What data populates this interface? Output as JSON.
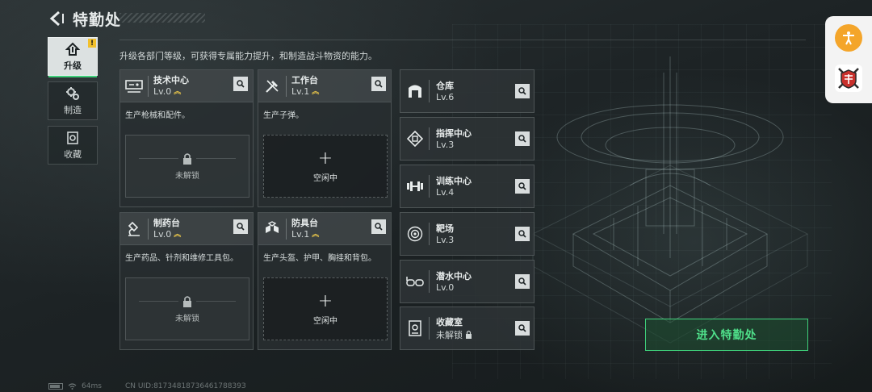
{
  "header": {
    "title": "特勤处"
  },
  "description": "升级各部门等级，可获得专属能力提升，和制造战斗物资的能力。",
  "nav": [
    {
      "label": "升级",
      "icon": "upgrade-icon",
      "active": true,
      "badge": "!"
    },
    {
      "label": "制造",
      "icon": "gear-icon",
      "active": false
    },
    {
      "label": "收藏",
      "icon": "collection-icon",
      "active": false
    }
  ],
  "cards": [
    {
      "name": "技术中心",
      "level": "Lv.0",
      "desc": "生产枪械和配件。",
      "slot": "未解锁",
      "icon": "tech-center-icon"
    },
    {
      "name": "工作台",
      "level": "Lv.1",
      "desc": "生产子弹。",
      "slot": "空闲中",
      "icon": "workbench-icon"
    },
    {
      "name": "制药台",
      "level": "Lv.0",
      "desc": "生产药品、针剂和维修工具包。",
      "slot": "未解锁",
      "icon": "pharmacy-icon"
    },
    {
      "name": "防具台",
      "level": "Lv.1",
      "desc": "生产头盔、护甲、胸挂和背包。",
      "slot": "空闲中",
      "icon": "armor-bench-icon"
    }
  ],
  "list": [
    {
      "name": "仓库",
      "level": "Lv.6",
      "icon": "warehouse-icon"
    },
    {
      "name": "指挥中心",
      "level": "Lv.3",
      "icon": "command-center-icon"
    },
    {
      "name": "训练中心",
      "level": "Lv.4",
      "icon": "training-center-icon"
    },
    {
      "name": "靶场",
      "level": "Lv.3",
      "icon": "shooting-range-icon"
    },
    {
      "name": "潜水中心",
      "level": "Lv.0",
      "icon": "diving-center-icon"
    },
    {
      "name": "收藏室",
      "level": "未解锁",
      "icon": "collection-room-icon"
    }
  ],
  "enter_button": "进入特勤处",
  "status": {
    "ping": "64ms",
    "uid": "CN UID:8173481873646178839З"
  },
  "colors": {
    "accent": "#3fd07a",
    "warning": "#f2c02c",
    "upgrade": "#e6c34a",
    "assist": "#f4a52a"
  }
}
